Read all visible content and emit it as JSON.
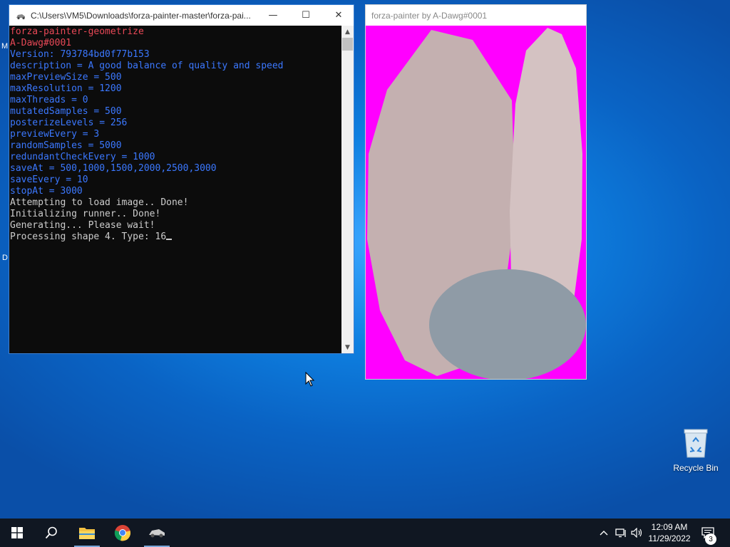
{
  "console_window": {
    "title": "C:\\Users\\VM5\\Downloads\\forza-painter-master\\forza-pai...",
    "minimize": "—",
    "maximize": "☐",
    "close": "✕",
    "lines": [
      {
        "text": "forza-painter-geometrize",
        "color": "red"
      },
      {
        "text": "A-Dawg#0001",
        "color": "red"
      },
      {
        "text": "Version: 793784bd0f77b153",
        "color": "blue"
      },
      {
        "text": "description = A good balance of quality and speed",
        "color": "blue"
      },
      {
        "text": "maxPreviewSize = 500",
        "color": "blue"
      },
      {
        "text": "maxResolution = 1200",
        "color": "blue"
      },
      {
        "text": "maxThreads = 0",
        "color": "blue"
      },
      {
        "text": "mutatedSamples = 500",
        "color": "blue"
      },
      {
        "text": "posterizeLevels = 256",
        "color": "blue"
      },
      {
        "text": "previewEvery = 3",
        "color": "blue"
      },
      {
        "text": "randomSamples = 5000",
        "color": "blue"
      },
      {
        "text": "redundantCheckEvery = 1000",
        "color": "blue"
      },
      {
        "text": "saveAt = 500,1000,1500,2000,2500,3000",
        "color": "blue"
      },
      {
        "text": "saveEvery = 10",
        "color": "blue"
      },
      {
        "text": "stopAt = 3000",
        "color": "blue"
      },
      {
        "text": "Attempting to load image.. Done!",
        "color": "white"
      },
      {
        "text": "Initializing runner.. Done!",
        "color": "white"
      },
      {
        "text": "Generating... Please wait!",
        "color": "white"
      },
      {
        "text": "Processing shape 4. Type: 16",
        "color": "white",
        "cursor": true
      }
    ]
  },
  "painter_window": {
    "title": "forza-painter by A-Dawg#0001"
  },
  "desktop": {
    "clipped_left_labels": [
      "M",
      "D"
    ],
    "recycle_bin_label": "Recycle Bin"
  },
  "taskbar": {
    "apps": [
      {
        "name": "start",
        "icon": "windows-logo-icon"
      },
      {
        "name": "search",
        "icon": "search-icon"
      },
      {
        "name": "file-explorer",
        "icon": "folder-icon",
        "active": true
      },
      {
        "name": "chrome",
        "icon": "chrome-icon"
      },
      {
        "name": "forza-painter",
        "icon": "car-icon",
        "active": true
      }
    ],
    "tray": {
      "time": "12:09 AM",
      "date": "11/29/2022",
      "notification_count": "3"
    }
  },
  "colors": {
    "console_red": "#e74856",
    "console_blue": "#3b78ff",
    "console_white": "#cccccc",
    "canvas_background": "#ff00ff",
    "shape_light_pink": "#d4c2c2",
    "shape_mauve": "#c4b0b0",
    "shape_slate": "#8f9ba6"
  }
}
